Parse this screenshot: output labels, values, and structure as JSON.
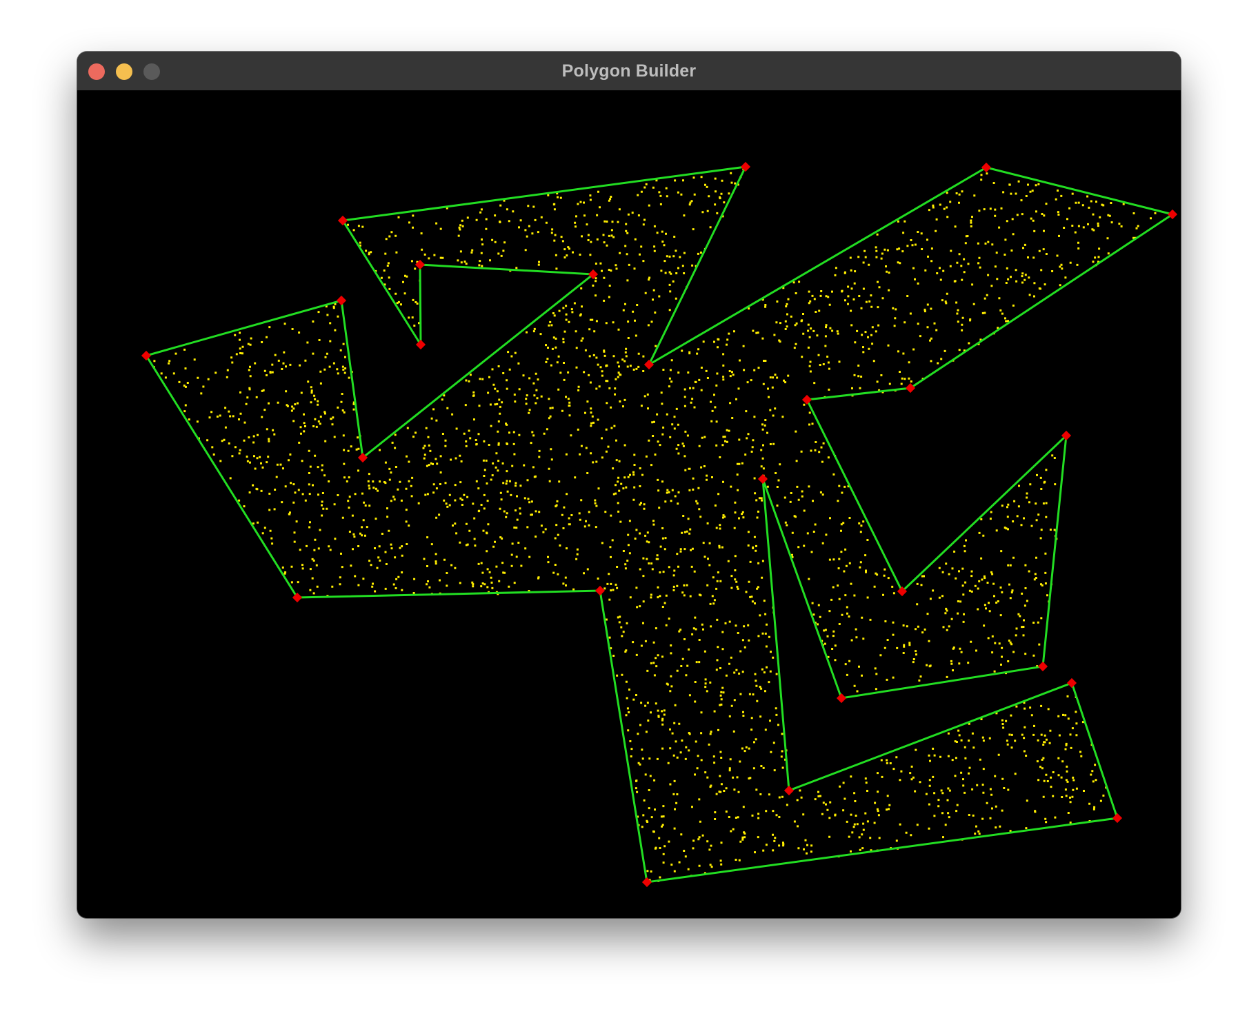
{
  "window": {
    "title": "Polygon Builder"
  },
  "controls": {
    "close": "close-button",
    "minimize": "minimize-button",
    "zoom": "zoom-button"
  },
  "colors": {
    "background": "#000000",
    "edge": "#22dd22",
    "vertex": "#ee0000",
    "sample_point": "#ffee00",
    "titlebar": "#363636",
    "title_text": "#bdbdbd"
  },
  "polygon": {
    "vertex_count": 24,
    "sample_point_count": 3000
  }
}
